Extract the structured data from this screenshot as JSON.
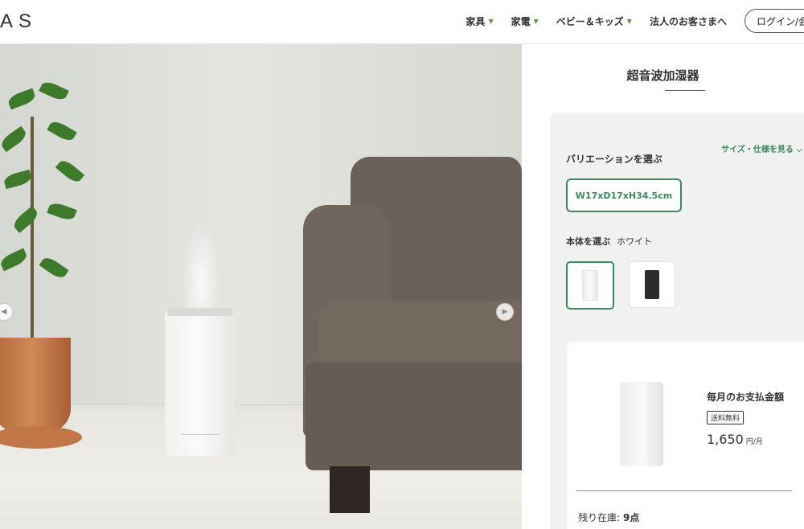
{
  "header": {
    "logo": "AS",
    "nav": [
      {
        "label": "家具",
        "caret": "▼"
      },
      {
        "label": "家電",
        "caret": "▼"
      },
      {
        "label": "ベビー＆キッズ",
        "caret": "▼"
      },
      {
        "label": "法人のお客さまへ"
      }
    ],
    "login_label": "ログイン/会"
  },
  "hero": {
    "prev_icon": "◀",
    "next_icon": "▶"
  },
  "product": {
    "title": "超音波加湿器",
    "spec_link": "サイズ・仕様を見る ⌵",
    "variation_label": "バリエーションを選ぶ",
    "variation_selected": "W17xD17xH34.5cm",
    "body_label": "本体を選ぶ",
    "body_color": "ホワイト",
    "colors": {
      "white": "#f4f4f2",
      "black": "#2b2b2b",
      "accent": "#3b8a5e"
    }
  },
  "payment": {
    "title": "毎月のお支払金額",
    "badge": "送料無料",
    "price": "1,650",
    "unit": "円/月",
    "stock_label": "残り在庫:",
    "stock_value": "9点"
  }
}
